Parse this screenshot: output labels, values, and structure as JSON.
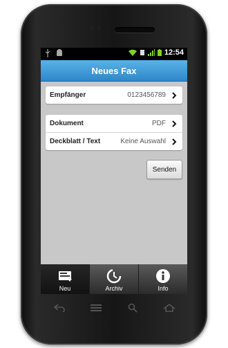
{
  "status_bar": {
    "time": "12:54",
    "icons": [
      "usb-icon",
      "android-icon",
      "wifi-icon",
      "sync-icon",
      "signal-icon",
      "battery-icon"
    ]
  },
  "titlebar": {
    "title": "Neues Fax"
  },
  "recipient": {
    "label": "Empfänger",
    "value": "0123456789"
  },
  "document": {
    "label": "Dokument",
    "value": "PDF"
  },
  "cover": {
    "label": "Deckblatt / Text",
    "value": "Keine Auswahl"
  },
  "send_label": "Senden",
  "tabs": [
    {
      "label": "Neu",
      "icon": "new-fax-icon",
      "active": true
    },
    {
      "label": "Archiv",
      "icon": "archive-icon",
      "active": false
    },
    {
      "label": "Info",
      "icon": "info-icon",
      "active": false
    }
  ],
  "colors": {
    "titlebar": "#3d95d6",
    "tabbar": "#3a3a3a",
    "screen_bg": "#c8c8c8"
  }
}
